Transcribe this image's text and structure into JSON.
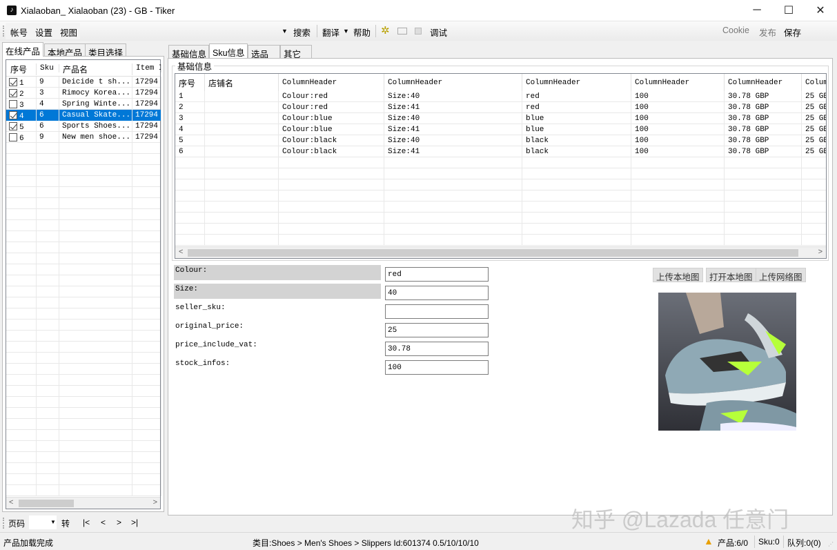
{
  "window": {
    "title": "Xialaoban_ Xialaoban (23) - GB - Tiker",
    "icon": "tiktok-icon"
  },
  "toolbar": {
    "left": [
      "帐号",
      "设置",
      "视图"
    ],
    "search": "搜索",
    "translate": "翻译",
    "help": "帮助",
    "debug": "调试",
    "cookie": "Cookie",
    "publish": "发布",
    "save": "保存"
  },
  "left_tabs": [
    "在线产品",
    "本地产品",
    "类目选择"
  ],
  "product_list": {
    "headers": [
      "序号",
      "Sku",
      "产品名",
      "Item I"
    ],
    "rows": [
      {
        "checked": true,
        "no": "1",
        "sku": "9",
        "name": "Deicide t sh...",
        "item": "17294"
      },
      {
        "checked": true,
        "no": "2",
        "sku": "3",
        "name": "Rimocy Korea...",
        "item": "17294"
      },
      {
        "checked": false,
        "no": "3",
        "sku": "4",
        "name": "Spring Winte...",
        "item": "17294"
      },
      {
        "checked": true,
        "no": "4",
        "sku": "6",
        "name": "Casual Skate...",
        "item": "17294",
        "selected": true
      },
      {
        "checked": true,
        "no": "5",
        "sku": "6",
        "name": "Sports Shoes...",
        "item": "17294"
      },
      {
        "checked": false,
        "no": "6",
        "sku": "9",
        "name": "New men shoe...",
        "item": "17294"
      }
    ]
  },
  "pager": {
    "label": "页码",
    "go": "转",
    "first": "|<",
    "prev": "<",
    "next": ">",
    "last": ">|"
  },
  "right_tabs": [
    "基础信息",
    "Sku信息",
    "选品",
    "其它"
  ],
  "active_right_tab": 1,
  "group_title": "基础信息",
  "sku_grid": {
    "headers": [
      "序号",
      "店铺名",
      "ColumnHeader",
      "ColumnHeader",
      "ColumnHeader",
      "ColumnHeader",
      "ColumnHeader",
      "Colum"
    ],
    "rows": [
      [
        "1",
        "",
        "Colour:red",
        "Size:40",
        "red",
        "100",
        "30.78 GBP",
        "25 GB"
      ],
      [
        "2",
        "",
        "Colour:red",
        "Size:41",
        "red",
        "100",
        "30.78 GBP",
        "25 GB"
      ],
      [
        "3",
        "",
        "Colour:blue",
        "Size:40",
        "blue",
        "100",
        "30.78 GBP",
        "25 GB"
      ],
      [
        "4",
        "",
        "Colour:blue",
        "Size:41",
        "blue",
        "100",
        "30.78 GBP",
        "25 GB"
      ],
      [
        "5",
        "",
        "Colour:black",
        "Size:40",
        "black",
        "100",
        "30.78 GBP",
        "25 GB"
      ],
      [
        "6",
        "",
        "Colour:black",
        "Size:41",
        "black",
        "100",
        "30.78 GBP",
        "25 GB"
      ]
    ]
  },
  "form": [
    {
      "label": "Colour:",
      "value": "red",
      "highlight": true
    },
    {
      "label": "Size:",
      "value": "40",
      "highlight": true
    },
    {
      "label": "seller_sku:",
      "value": ""
    },
    {
      "label": "original_price:",
      "value": "25"
    },
    {
      "label": "price_include_vat:",
      "value": "30.78"
    },
    {
      "label": "stock_infos:",
      "value": "100"
    }
  ],
  "image_buttons": [
    "上传本地图",
    "打开本地图",
    "上传网络图"
  ],
  "watermark": "知乎 @Lazada 任意门",
  "status": {
    "left": "产品加载完成",
    "category": "类目:Shoes > Men's Shoes  > Slippers  Id:601374  0.5/10/10/10",
    "products": "产品:6/0",
    "sku": "Sku:0",
    "queue": "队列:0(0)"
  }
}
